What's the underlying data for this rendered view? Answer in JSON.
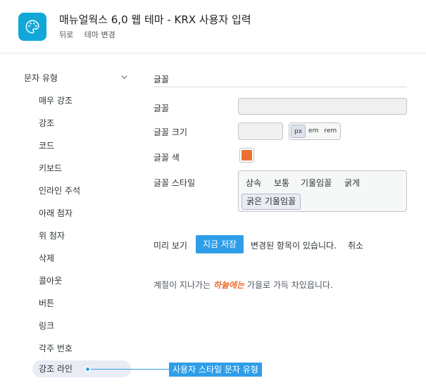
{
  "header": {
    "title": "매뉴얼웍스 6,0 웹 테마 - KRX 사용자 입력",
    "links": [
      "뒤로",
      "테마 변경"
    ]
  },
  "sidebar": {
    "heading": "문자 유형",
    "items": [
      "매우 강조",
      "강조",
      "코드",
      "키보드",
      "인라인 주석",
      "아래 첨자",
      "위 첨자",
      "삭제",
      "콜아웃",
      "버튼",
      "링크",
      "각주 번호",
      "강조 라인"
    ],
    "active_index": 12
  },
  "main": {
    "section_title": "글꼴",
    "font_label": "글꼴",
    "font_value": "",
    "size_label": "글꼴 크기",
    "size_value": "",
    "units": [
      "px",
      "em",
      "rem"
    ],
    "selected_unit": "px",
    "color_label": "글꼴 색",
    "font_color": "#ec7031",
    "style_label": "글꼴 스타일",
    "styles": [
      "상속",
      "보통",
      "기울임꼴",
      "굵게",
      "굵은 기울임꼴"
    ],
    "selected_style": "굵은 기울임꼴"
  },
  "actions": {
    "preview": "미리 보기",
    "save_now": "지금 저장",
    "changed_note": "변경된 항목이 있습니다.",
    "cancel": "취소"
  },
  "sample": {
    "before": "계절이 지나가는 ",
    "highlight": "하늘에는",
    "after": " 가을로 가득 차있읍니다."
  },
  "callout": {
    "label": "사용자 스타일 문자 유형"
  },
  "colors": {
    "accent": "#2f9ee8",
    "app_icon": "#11a7d9",
    "highlight": "#ec7031"
  }
}
